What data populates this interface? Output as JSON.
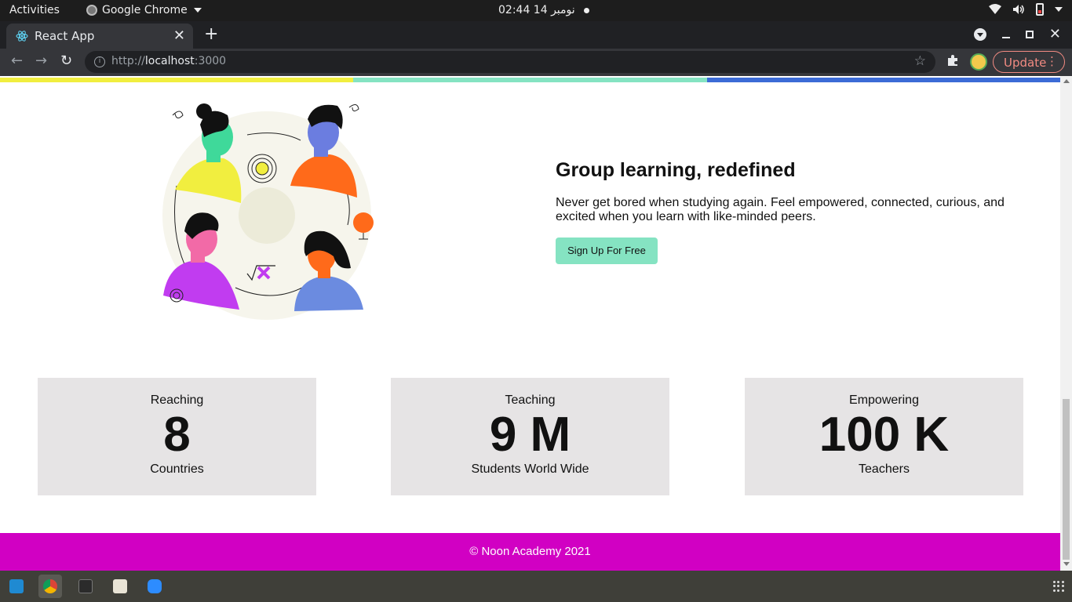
{
  "os": {
    "activities": "Activities",
    "app_menu": "Google Chrome",
    "clock": "02:44  14 نومبر"
  },
  "browser": {
    "tab_title": "React App",
    "url_scheme": "http://",
    "url_host": "localhost",
    "url_port": ":3000",
    "update_label": "Update"
  },
  "page": {
    "colorbar": [
      "#f1ee3f",
      "#85e3c2",
      "#3c6bd6"
    ],
    "hero": {
      "title": "Group learning, redefined",
      "description": "Never get bored when studying again. Feel empowered, connected, curious, and excited when you learn with like-minded peers.",
      "cta": "Sign Up For Free"
    },
    "stats": [
      {
        "top": "Reaching",
        "value": "8",
        "bottom": "Countries"
      },
      {
        "top": "Teaching",
        "value": "9 M",
        "bottom": "Students World Wide"
      },
      {
        "top": "Empowering",
        "value": "100 K",
        "bottom": "Teachers"
      }
    ],
    "footer": "© Noon Academy 2021",
    "accent_colors": {
      "cta": "#85e3c2",
      "footer": "#d100c3",
      "card": "#e6e4e5"
    }
  },
  "dock": {
    "apps": [
      "vscode-icon",
      "chrome-icon",
      "terminal-icon",
      "files-icon",
      "zoom-icon"
    ]
  }
}
